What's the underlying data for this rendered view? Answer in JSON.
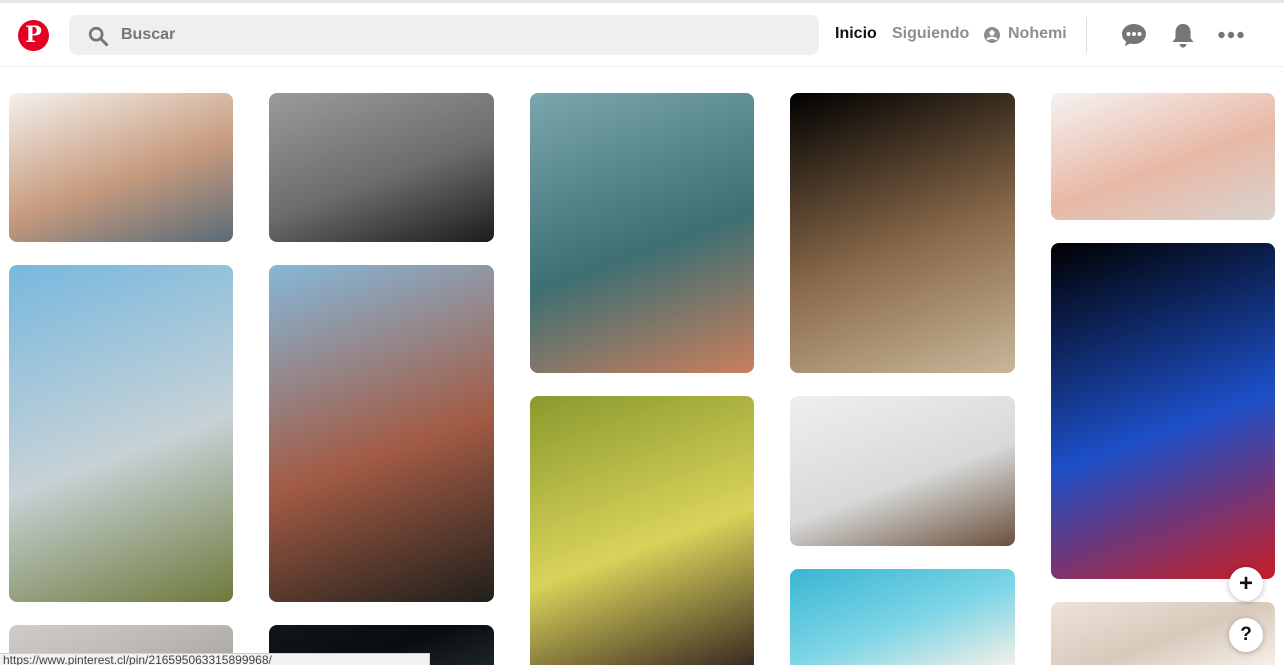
{
  "header": {
    "search": {
      "placeholder": "Buscar",
      "value": ""
    },
    "nav": {
      "home": "Inicio",
      "following": "Siguiendo",
      "user": "Nohemi"
    },
    "brand_color": "#e60023"
  },
  "pins": [
    {
      "id": "barista-counter",
      "colors": [
        "#f4f1ec",
        "#c79b7e",
        "#5a6b78"
      ]
    },
    {
      "id": "motorcycle",
      "colors": [
        "#9b9b9b",
        "#6c6c6c",
        "#1c1c1c"
      ]
    },
    {
      "id": "ocean-wave",
      "colors": [
        "#7aa7ad",
        "#3d6f73",
        "#c97f5c"
      ]
    },
    {
      "id": "bread-hands",
      "colors": [
        "#000000",
        "#8a6a4a",
        "#c8b79a"
      ]
    },
    {
      "id": "bathroom-shelf",
      "colors": [
        "#f5f3f1",
        "#e8b8a6",
        "#d9d3cd"
      ]
    },
    {
      "id": "misty-mountain",
      "colors": [
        "#77b8de",
        "#c7d2d6",
        "#6e7a3c"
      ]
    },
    {
      "id": "canyon-valley",
      "colors": [
        "#86b8d9",
        "#a25b44",
        "#1f1f1b"
      ]
    },
    {
      "id": "woman-hat",
      "colors": [
        "#8a9a2e",
        "#d9d35a",
        "#3b2a22"
      ]
    },
    {
      "id": "office-space",
      "colors": [
        "#eef0f0",
        "#d7dad9",
        "#6b4f3b"
      ]
    },
    {
      "id": "neon-lights",
      "colors": [
        "#000000",
        "#1d4fc7",
        "#c81d24"
      ]
    },
    {
      "id": "grey-bottom",
      "colors": [
        "#d0cdc8",
        "#bdb9b4",
        "#a9a5a0"
      ]
    },
    {
      "id": "dark-bottom",
      "colors": [
        "#121619",
        "#0a0d0f",
        "#1c2428"
      ]
    },
    {
      "id": "turquoise-pools",
      "colors": [
        "#38b6d4",
        "#7fd6e6",
        "#f3efe8"
      ]
    },
    {
      "id": "soft-blur",
      "colors": [
        "#eee3d9",
        "#d8c9bb",
        "#f5efe9"
      ]
    }
  ],
  "floating": {
    "add_label": "+",
    "help_label": "?"
  },
  "status_url": "https://www.pinterest.cl/pin/216595063315899968/"
}
